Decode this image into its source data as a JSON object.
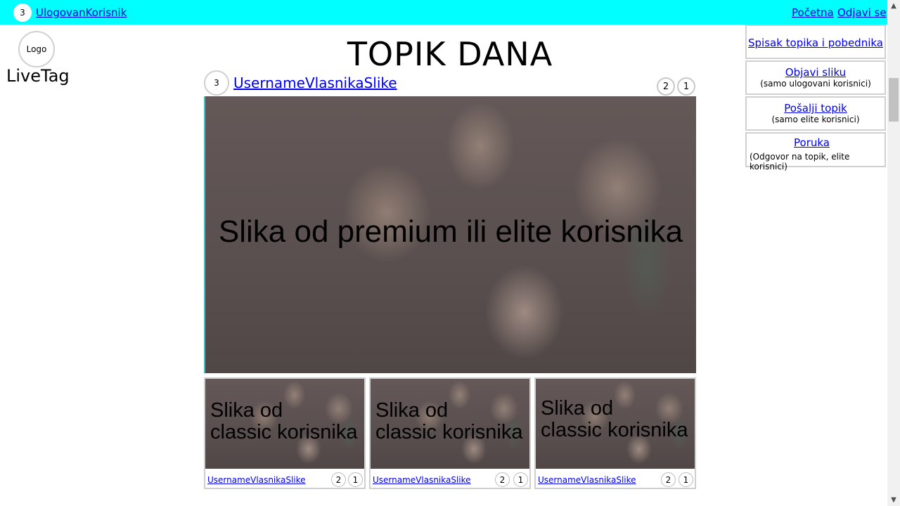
{
  "topbar": {
    "user_badge": "3",
    "user_name": "UlogovanKorisnik",
    "home": "Početna",
    "logout": "Odjavi se"
  },
  "logo": {
    "circle_text": "Logo",
    "name": "LiveTag"
  },
  "page_title": "TOPIK DANA",
  "featured": {
    "owner_badge": "3",
    "owner_name": "UsernameVlasnikaSlike",
    "count_a": "2",
    "count_b": "1",
    "caption": "Slika od premium ili elite korisnika"
  },
  "thumbs": [
    {
      "caption_line1": "Slika od",
      "caption_line2": "classic korisnika",
      "user": "UsernameVlasnikaSlike",
      "count_a": "2",
      "count_b": "1"
    },
    {
      "caption_line1": "Slika od",
      "caption_line2": "classic korisnika",
      "user": "UsernameVlasnikaSlike",
      "count_a": "2",
      "count_b": "1"
    },
    {
      "caption_line1": "Slika od",
      "caption_line2": "classic korisnika",
      "user": "UsernameVlasnikaSlike",
      "count_a": "2",
      "count_b": "1"
    }
  ],
  "sidebar": {
    "items": [
      {
        "label": "Spisak topika i pobednika",
        "sub": ""
      },
      {
        "label": "Objavi sliku",
        "sub": "(samo ulogovani korisnici)"
      },
      {
        "label": "Pošalji topik",
        "sub": "(samo elite korisnici)"
      },
      {
        "label": "Poruka",
        "sub": "(Odgovor na topik, elite korisnici)"
      }
    ]
  },
  "colors": {
    "topbar": "#00ffff",
    "link": "#0000ee"
  },
  "icons": {
    "scroll_up": "arrow-up-icon",
    "scroll_down": "arrow-down-icon"
  }
}
